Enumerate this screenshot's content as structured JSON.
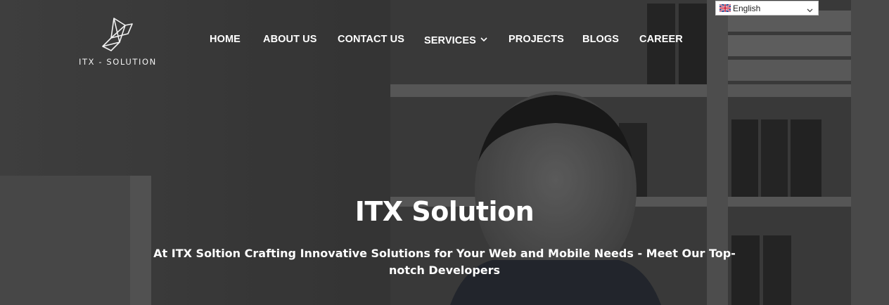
{
  "brand": {
    "name": "ITX - SOLUTION"
  },
  "nav": {
    "items": [
      {
        "label": "HOME"
      },
      {
        "label": "ABOUT US"
      },
      {
        "label": "CONTACT US"
      },
      {
        "label": "SERVICES",
        "has_dropdown": true
      },
      {
        "label": "PROJECTS"
      },
      {
        "label": "BLOGS"
      },
      {
        "label": "CAREER"
      }
    ]
  },
  "language": {
    "selected": "English",
    "flag": "uk-flag-icon"
  },
  "hero": {
    "title": "ITX Solution",
    "subtitle": "At ITX Soltion Crafting Innovative Solutions for Your Web and Mobile Needs - Meet Our Top-notch Developers",
    "image": "office-man-at-computer-photo"
  },
  "colors": {
    "text": "#ffffff",
    "overlay": "#3a3a3a"
  }
}
